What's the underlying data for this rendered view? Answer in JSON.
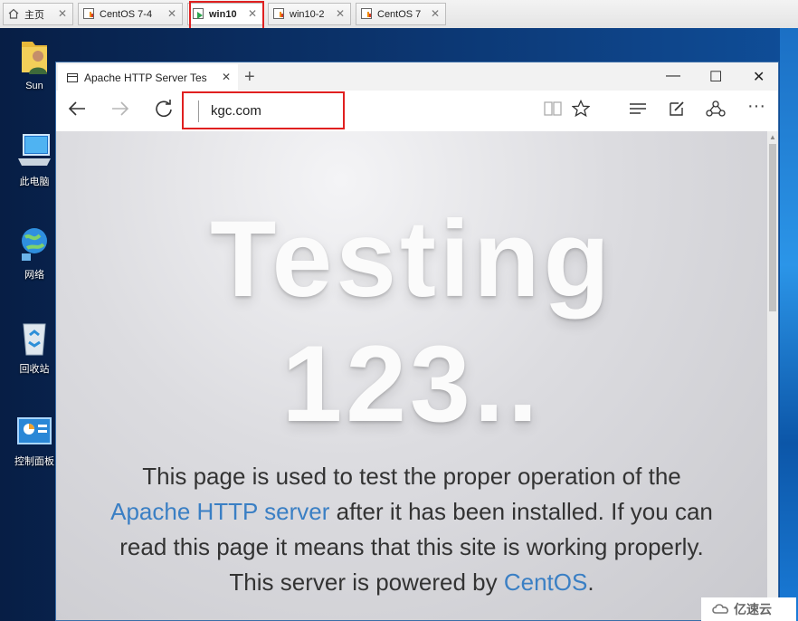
{
  "vm_tabs": [
    {
      "label": "主页",
      "icon": "home-icon"
    },
    {
      "label": "CentOS 7-4",
      "icon": "vm-icon"
    },
    {
      "label": "win10",
      "icon": "vm-running-icon",
      "active": true
    },
    {
      "label": "win10-2",
      "icon": "vm-icon"
    },
    {
      "label": "CentOS 7",
      "icon": "vm-icon"
    }
  ],
  "desktop_icons": [
    {
      "label": "Sun",
      "icon": "user-folder-icon"
    },
    {
      "label": "此电脑",
      "icon": "computer-icon"
    },
    {
      "label": "网络",
      "icon": "network-icon"
    },
    {
      "label": "回收站",
      "icon": "recycle-bin-icon"
    },
    {
      "label": "控制面板",
      "icon": "control-panel-icon"
    }
  ],
  "browser": {
    "tab_title": "Apache HTTP Server Tes",
    "address": "kgc.com",
    "page": {
      "heading_line1": "Testing",
      "heading_line2": "123..",
      "text_1": "This page is used to test the proper operation of the",
      "link_apache": "Apache HTTP server",
      "text_2": " after it has been installed. If you can read this page it means that this site is working properly. This server is powered by ",
      "link_centos": "CentOS",
      "text_3": "."
    }
  },
  "watermark": "亿速云",
  "colors": {
    "link": "#3a7fc4",
    "highlight_box": "#e02020"
  }
}
